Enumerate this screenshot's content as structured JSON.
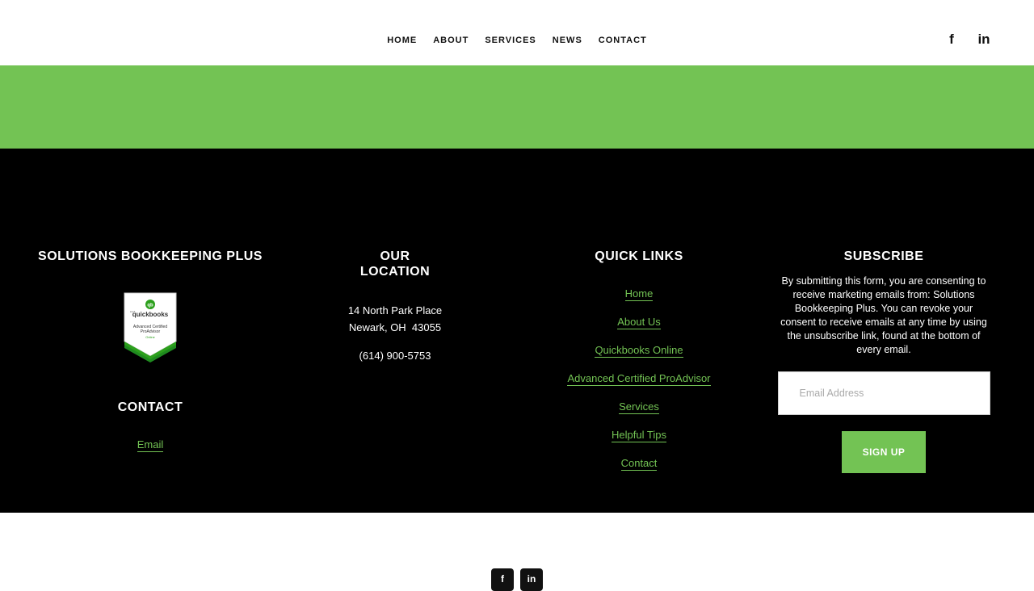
{
  "nav": {
    "items": [
      "HOME",
      "ABOUT",
      "SERVICES",
      "NEWS",
      "CONTACT"
    ]
  },
  "social": {
    "facebook_glyph": "f",
    "linkedin_glyph": "in"
  },
  "colors": {
    "accent": "#73c354",
    "footer_bg": "#000000"
  },
  "footer": {
    "company": {
      "title": "SOLUTIONS BOOKKEEPING PLUS",
      "badge_icon": "quickbooks-proadvisor-badge",
      "badge_text": {
        "small": "intuit",
        "brand": "quickbooks",
        "line1": "Advanced Certified",
        "line2": "ProAdvisor",
        "line3": "Online"
      },
      "contact_title": "CONTACT",
      "email_link": "Email"
    },
    "location": {
      "title": "OUR LOCATION",
      "address_line1": "14 North Park Place",
      "address_line2": "Newark, OH  43055",
      "phone": "(614) 900-5753"
    },
    "quick_links": {
      "title": "QUICK LINKS",
      "links": [
        "Home",
        "About Us",
        "Quickbooks Online",
        "Advanced Certified ProAdvisor",
        "Services",
        "Helpful Tips",
        "Contact"
      ]
    },
    "subscribe": {
      "title": "SUBSCRIBE",
      "description": "By submitting this form, you are consenting to receive marketing emails from: Solutions Bookkeeping Plus. You can revoke your consent to receive emails at any time by using the unsubscribe link, found at the bottom of every email.",
      "email_placeholder": "Email Address",
      "button_label": "SIGN UP"
    }
  }
}
